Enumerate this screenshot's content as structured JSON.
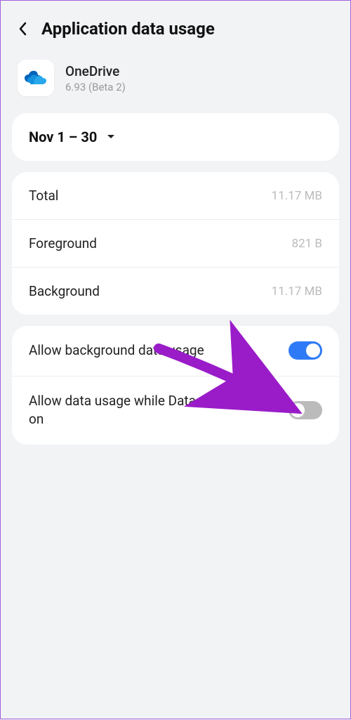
{
  "header": {
    "title": "Application data usage"
  },
  "app": {
    "name": "OneDrive",
    "subtitle": "6.93 (Beta 2)"
  },
  "date_range": {
    "label": "Nov 1 – 30"
  },
  "stats": [
    {
      "label": "Total",
      "value": "11.17 MB"
    },
    {
      "label": "Foreground",
      "value": "821 B"
    },
    {
      "label": "Background",
      "value": "11.17 MB"
    }
  ],
  "toggles": [
    {
      "label": "Allow background data usage",
      "on": true
    },
    {
      "label": "Allow data usage while Data saver is on",
      "on": false
    }
  ],
  "annotation": {
    "color": "#9a1cc9"
  }
}
